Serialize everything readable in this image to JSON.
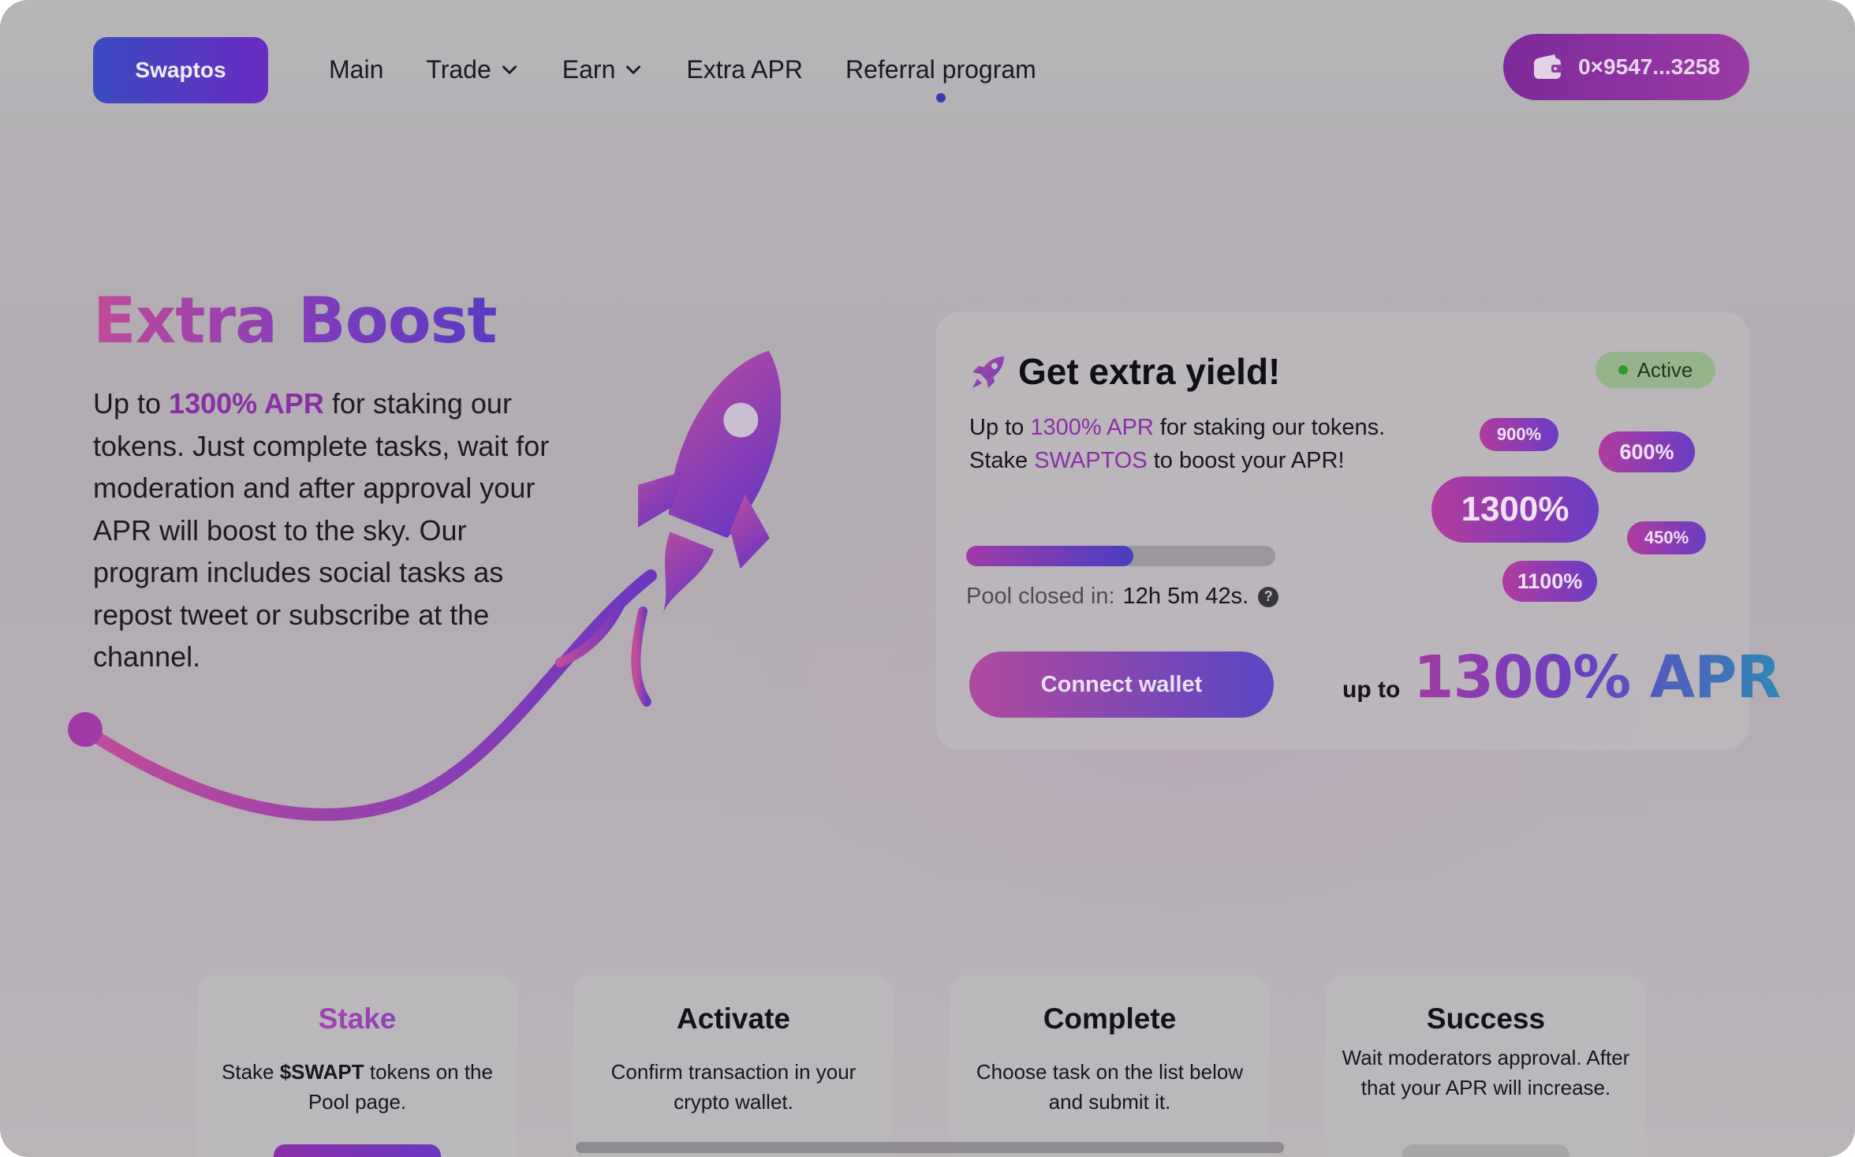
{
  "header": {
    "logo_label": "Swaptos",
    "nav": [
      {
        "label": "Main",
        "dropdown": false,
        "active": false
      },
      {
        "label": "Trade",
        "dropdown": true,
        "active": false
      },
      {
        "label": "Earn",
        "dropdown": true,
        "active": false
      },
      {
        "label": "Extra APR",
        "dropdown": false,
        "active": false
      },
      {
        "label": "Referral program",
        "dropdown": false,
        "active": true
      }
    ],
    "wallet_address": "0×9547...3258"
  },
  "hero": {
    "title": "Extra Boost",
    "desc_prefix": "Up to ",
    "desc_highlight": "1300% APR",
    "desc_rest": " for staking our tokens. Just complete tasks, wait for moderation and after approval your APR will boost to the sky. Our program includes social tasks as repost tweet or subscribe at the channel."
  },
  "card": {
    "title": "Get extra yield!",
    "status": "Active",
    "line1_prefix": "Up to ",
    "line1_highlight": "1300% APR",
    "line1_rest": " for staking our tokens.",
    "line2_prefix": "Stake ",
    "line2_highlight": "SWAPTOS",
    "line2_rest": " to boost your APR!",
    "progress_fraction": 0.54,
    "pool_label": "Pool closed in:",
    "pool_time": "12h 5m 42s.",
    "help_glyph": "?",
    "connect_label": "Connect wallet",
    "upto_label": "up to",
    "big_apr": "1300% APR",
    "pills": [
      "900%",
      "600%",
      "1300%",
      "450%",
      "1100%"
    ]
  },
  "steps": [
    {
      "title": "Stake",
      "text_prefix": "Stake ",
      "text_bold": "$SWAPT",
      "text_rest": " tokens on the Pool page."
    },
    {
      "title": "Activate",
      "text": "Confirm transaction in your crypto wallet."
    },
    {
      "title": "Complete",
      "text": "Choose task on the list below and submit it."
    },
    {
      "title": "Success",
      "text": "Wait moderators approval. After that your APR will increase."
    }
  ],
  "colors": {
    "accent_purple": "#8a2fa8",
    "accent_blue": "#3a4bc0",
    "status_green": "#2f9a2a"
  },
  "icons": {
    "wallet": "wallet-icon",
    "rocket": "rocket-icon",
    "chevron": "chevron-down-icon",
    "help": "help-icon"
  }
}
